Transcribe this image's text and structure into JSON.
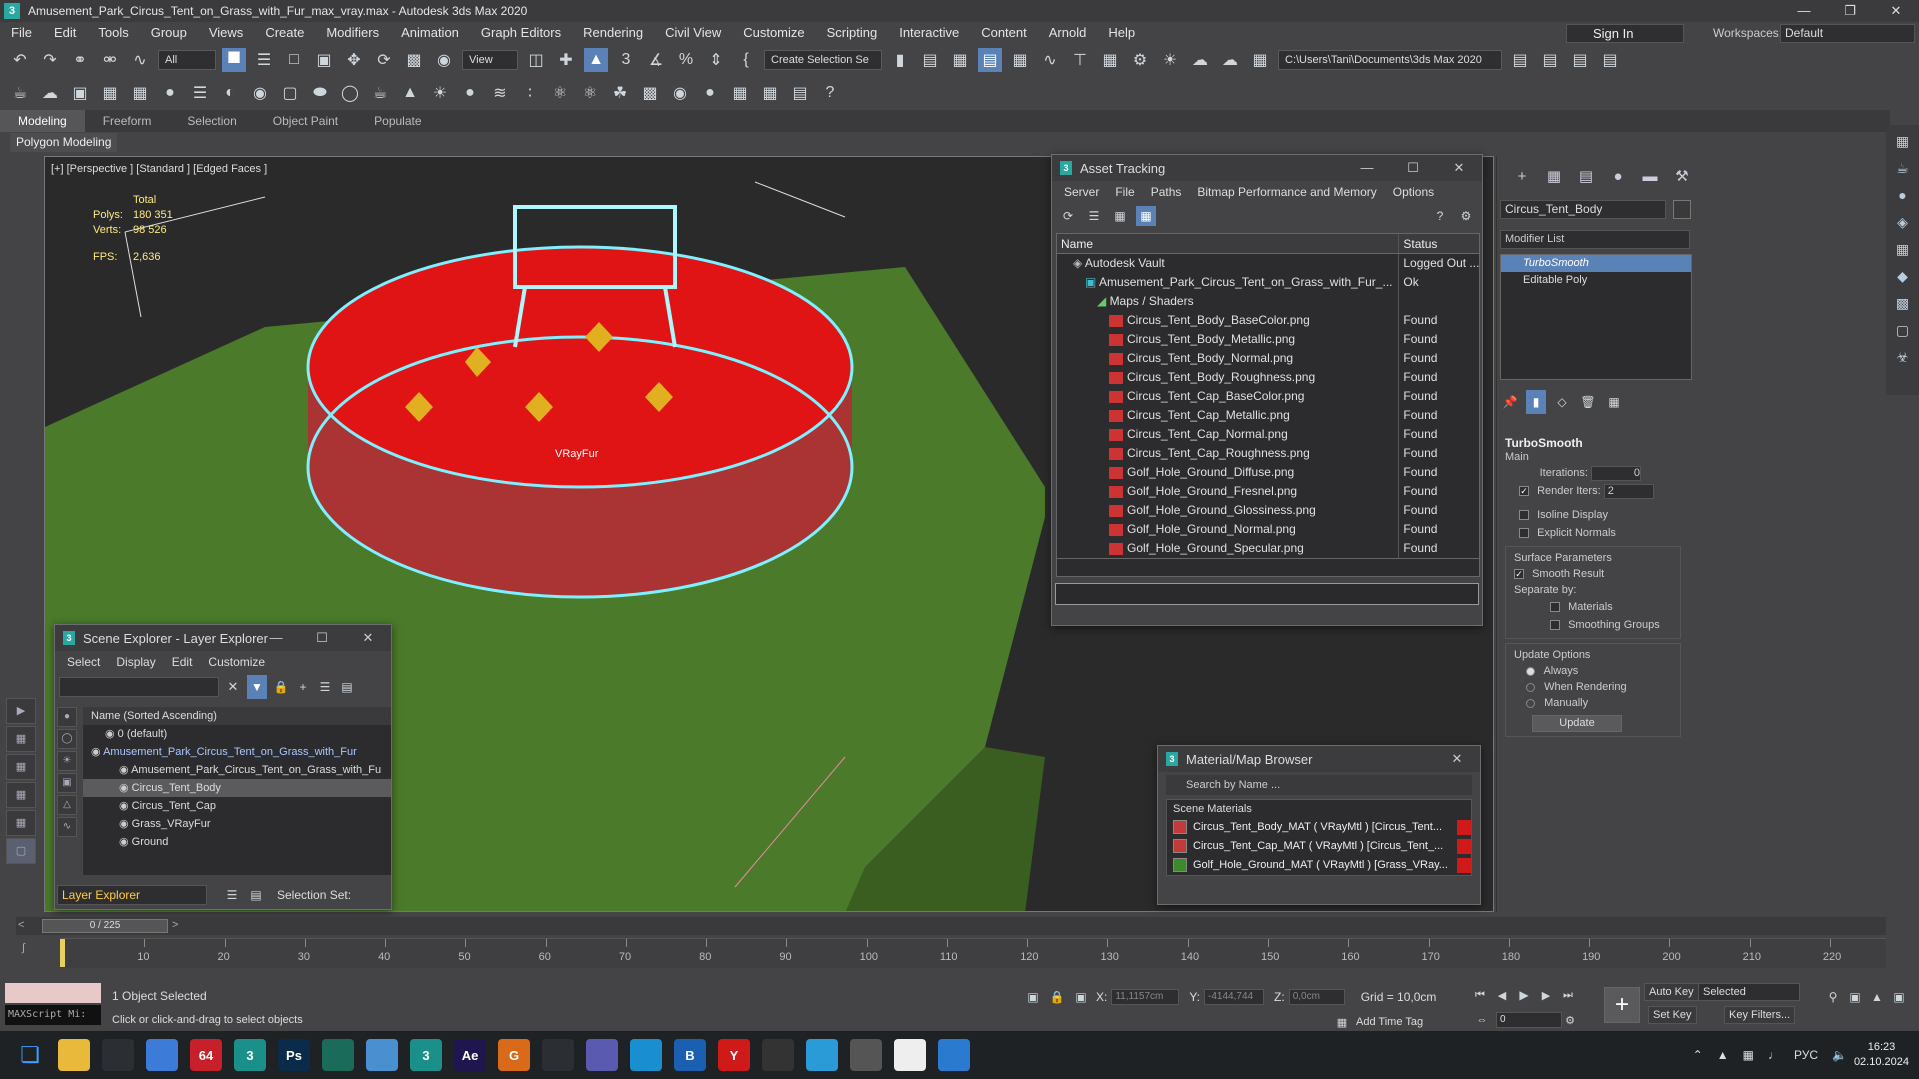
{
  "window": {
    "title": "Amusement_Park_Circus_Tent_on_Grass_with_Fur_max_vray.max - Autodesk 3ds Max 2020",
    "app_logo": "3"
  },
  "menu": [
    "File",
    "Edit",
    "Tools",
    "Group",
    "Views",
    "Create",
    "Modifiers",
    "Animation",
    "Graph Editors",
    "Rendering",
    "Civil View",
    "Customize",
    "Scripting",
    "Interactive",
    "Content",
    "Arnold",
    "Help"
  ],
  "account": {
    "sign_in": "Sign In",
    "workspaces_label": "Workspaces:",
    "workspace": "Default"
  },
  "toolbar": {
    "filter": "All",
    "ref_coord": "View",
    "selection_set": "Create Selection Se",
    "project_path": "C:\\Users\\Tani\\Documents\\3ds Max 2020"
  },
  "ribbon": {
    "tabs": [
      "Modeling",
      "Freeform",
      "Selection",
      "Object Paint",
      "Populate"
    ],
    "active_tab": "Modeling",
    "sub_panel": "Polygon Modeling"
  },
  "viewport": {
    "label": "[+] [Perspective ] [Standard ] [Edged Faces ]",
    "stats_header": "Total",
    "polys_label": "Polys:",
    "polys": "180 351",
    "verts_label": "Verts:",
    "verts": "98 526",
    "fps_label": "FPS:",
    "fps": "2,636",
    "object_label": "VRayFur"
  },
  "asset_tracking": {
    "title": "Asset Tracking",
    "menu": [
      "Server",
      "File",
      "Paths",
      "Bitmap Performance and Memory",
      "Options"
    ],
    "columns": [
      "Name",
      "Status"
    ],
    "rows": [
      {
        "name": "Autodesk Vault",
        "status": "Logged Out ...",
        "indent": 1,
        "kind": "vault"
      },
      {
        "name": "Amusement_Park_Circus_Tent_on_Grass_with_Fur_...",
        "status": "Ok",
        "indent": 2,
        "kind": "max"
      },
      {
        "name": "Maps / Shaders",
        "status": "",
        "indent": 3,
        "kind": "folder"
      },
      {
        "name": "Circus_Tent_Body_BaseColor.png",
        "status": "Found",
        "indent": 4,
        "kind": "png"
      },
      {
        "name": "Circus_Tent_Body_Metallic.png",
        "status": "Found",
        "indent": 4,
        "kind": "png"
      },
      {
        "name": "Circus_Tent_Body_Normal.png",
        "status": "Found",
        "indent": 4,
        "kind": "png"
      },
      {
        "name": "Circus_Tent_Body_Roughness.png",
        "status": "Found",
        "indent": 4,
        "kind": "png"
      },
      {
        "name": "Circus_Tent_Cap_BaseColor.png",
        "status": "Found",
        "indent": 4,
        "kind": "png"
      },
      {
        "name": "Circus_Tent_Cap_Metallic.png",
        "status": "Found",
        "indent": 4,
        "kind": "png"
      },
      {
        "name": "Circus_Tent_Cap_Normal.png",
        "status": "Found",
        "indent": 4,
        "kind": "png"
      },
      {
        "name": "Circus_Tent_Cap_Roughness.png",
        "status": "Found",
        "indent": 4,
        "kind": "png"
      },
      {
        "name": "Golf_Hole_Ground_Diffuse.png",
        "status": "Found",
        "indent": 4,
        "kind": "png"
      },
      {
        "name": "Golf_Hole_Ground_Fresnel.png",
        "status": "Found",
        "indent": 4,
        "kind": "png"
      },
      {
        "name": "Golf_Hole_Ground_Glossiness.png",
        "status": "Found",
        "indent": 4,
        "kind": "png"
      },
      {
        "name": "Golf_Hole_Ground_Normal.png",
        "status": "Found",
        "indent": 4,
        "kind": "png"
      },
      {
        "name": "Golf_Hole_Ground_Specular.png",
        "status": "Found",
        "indent": 4,
        "kind": "png"
      }
    ]
  },
  "scene_explorer": {
    "title": "Scene Explorer - Layer Explorer",
    "menu": [
      "Select",
      "Display",
      "Edit",
      "Customize"
    ],
    "column": "Name (Sorted Ascending)",
    "rows": [
      {
        "name": "0 (default)",
        "indent": 1,
        "selected": false,
        "highlight": false
      },
      {
        "name": "Amusement_Park_Circus_Tent_on_Grass_with_Fur",
        "indent": 0,
        "selected": false,
        "highlight": true
      },
      {
        "name": "Amusement_Park_Circus_Tent_on_Grass_with_Fu",
        "indent": 2,
        "selected": false,
        "highlight": false
      },
      {
        "name": "Circus_Tent_Body",
        "indent": 2,
        "selected": true,
        "highlight": false
      },
      {
        "name": "Circus_Tent_Cap",
        "indent": 2,
        "selected": false,
        "highlight": false
      },
      {
        "name": "Grass_VRayFur",
        "indent": 2,
        "selected": false,
        "highlight": false
      },
      {
        "name": "Ground",
        "indent": 2,
        "selected": false,
        "highlight": false
      }
    ],
    "explorer_type": "Layer Explorer",
    "selection_set_label": "Selection Set:"
  },
  "material_browser": {
    "title": "Material/Map Browser",
    "search_placeholder": "Search by Name ...",
    "group": "Scene Materials",
    "items": [
      {
        "label": "Circus_Tent_Body_MAT  ( VRayMtl )  [Circus_Tent...",
        "swatch": "#c43a3a"
      },
      {
        "label": "Circus_Tent_Cap_MAT  ( VRayMtl )  [Circus_Tent_...",
        "swatch": "#c43a3a"
      },
      {
        "label": "Golf_Hole_Ground_MAT  ( VRayMtl )  [Grass_VRay...",
        "swatch": "#3c8a2a"
      }
    ]
  },
  "command_panel": {
    "object_name": "Circus_Tent_Body",
    "modifier_list": "Modifier List",
    "stack": [
      "TurboSmooth",
      "Editable Poly"
    ],
    "turbosmooth": {
      "title": "TurboSmooth",
      "main": "Main",
      "iterations_label": "Iterations:",
      "iterations": "0",
      "render_iters_label": "Render Iters:",
      "render_iters": "2",
      "isoline": "Isoline Display",
      "explicit_normals": "Explicit Normals",
      "surface_params": "Surface Parameters",
      "smooth_result": "Smooth Result",
      "separate_by": "Separate by:",
      "materials": "Materials",
      "smoothing_groups": "Smoothing Groups",
      "update_options": "Update Options",
      "always": "Always",
      "when_rendering": "When Rendering",
      "manually": "Manually",
      "update_button": "Update"
    }
  },
  "timeline": {
    "frame_counter": "0 / 225",
    "ticks": [
      "10",
      "20",
      "30",
      "40",
      "50",
      "60",
      "70",
      "80",
      "90",
      "100",
      "110",
      "120",
      "130",
      "140",
      "150",
      "160",
      "170",
      "180",
      "190",
      "200",
      "210",
      "220"
    ]
  },
  "status": {
    "selected": "1 Object Selected",
    "prompt": "Click or click-and-drag to select objects",
    "maxscript": "MAXScript Mi:",
    "x_label": "X:",
    "x": "11,1157cm",
    "y_label": "Y:",
    "y": "-4144,744",
    "z_label": "Z:",
    "z": "0,0cm",
    "grid": "Grid = 10,0cm",
    "add_time_tag": "Add Time Tag",
    "auto_key": "Auto Key",
    "set_key": "Set Key",
    "key_mode": "Selected",
    "key_filters": "Key Filters...",
    "current_frame": "0"
  },
  "taskbar": {
    "apps": [
      {
        "name": "file-explorer",
        "label": "",
        "color": "#e8b93a"
      },
      {
        "name": "task-view",
        "label": "",
        "color": "#2b2e33"
      },
      {
        "name": "chrome",
        "label": "",
        "color": "#3d7bd9"
      },
      {
        "name": "app-64",
        "label": "64",
        "color": "#c8202a"
      },
      {
        "name": "3dsmax-a",
        "label": "3",
        "color": "#1b8f8a"
      },
      {
        "name": "photoshop",
        "label": "Ps",
        "color": "#0a2b4a"
      },
      {
        "name": "app-green",
        "label": "",
        "color": "#1b6b5a"
      },
      {
        "name": "notepad",
        "label": "",
        "color": "#4a8fd0"
      },
      {
        "name": "3dsmax-b",
        "label": "3",
        "color": "#1b8f8a"
      },
      {
        "name": "after-effects",
        "label": "Ae",
        "color": "#1f1650"
      },
      {
        "name": "app-orange",
        "label": "G",
        "color": "#d86a1a"
      },
      {
        "name": "app-search",
        "label": "",
        "color": "#2b2e33"
      },
      {
        "name": "app-store",
        "label": "",
        "color": "#5a5ab0"
      },
      {
        "name": "edge",
        "label": "",
        "color": "#1a8fd0"
      },
      {
        "name": "app-blue",
        "label": "B",
        "color": "#1a5fb0"
      },
      {
        "name": "yandex",
        "label": "Y",
        "color": "#d01a1a"
      },
      {
        "name": "terminal",
        "label": "",
        "color": "#333"
      },
      {
        "name": "telegram",
        "label": "",
        "color": "#2a9bd6"
      },
      {
        "name": "calculator",
        "label": "",
        "color": "#555"
      },
      {
        "name": "document",
        "label": "",
        "color": "#eee"
      },
      {
        "name": "camera",
        "label": "",
        "color": "#2a7bd0"
      }
    ],
    "language": "РУС",
    "time": "16:23",
    "date": "02.10.2024"
  }
}
